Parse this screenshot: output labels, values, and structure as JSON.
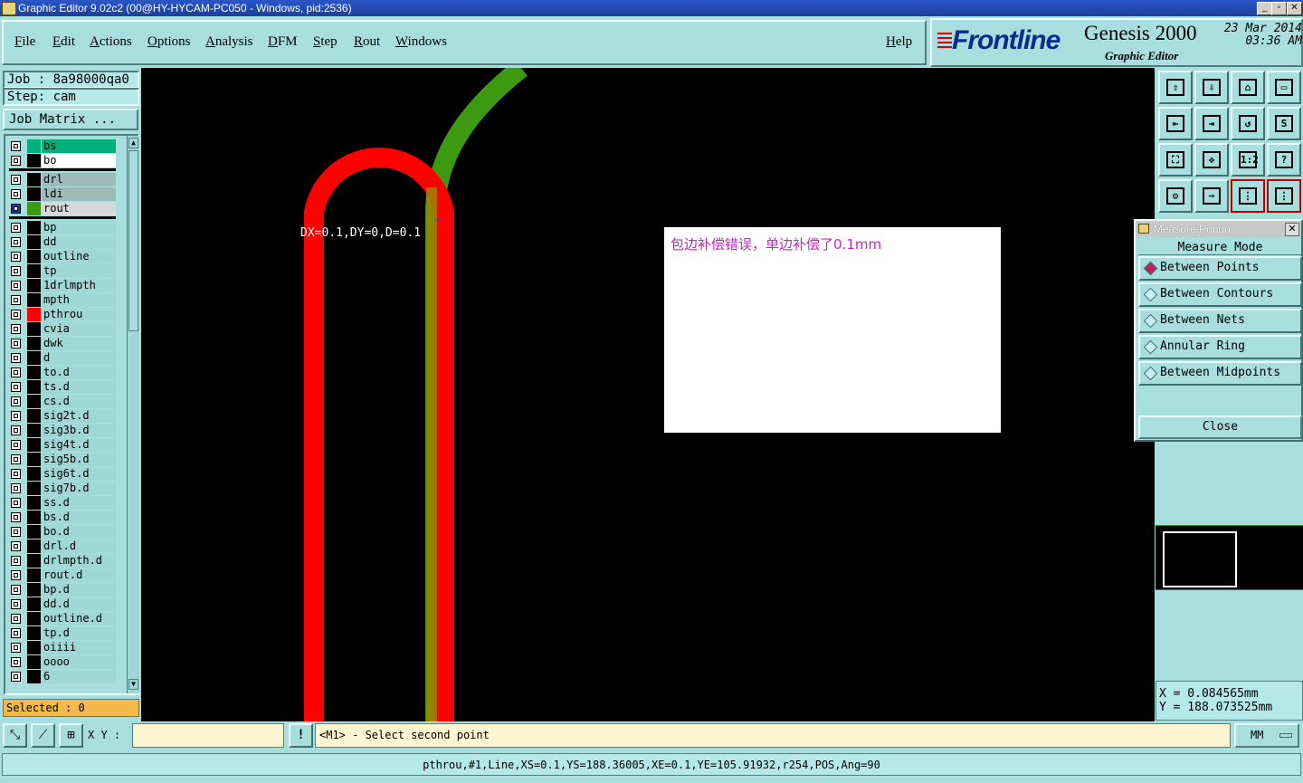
{
  "window": {
    "title": "Graphic Editor 9.02c2 (00@HY-HYCAM-PC050 - Windows, pid:2536)",
    "min": "_",
    "max": "▫",
    "close": "✕"
  },
  "menu": {
    "items": [
      "File",
      "Edit",
      "Actions",
      "Options",
      "Analysis",
      "DFM",
      "Step",
      "Rout",
      "Windows"
    ],
    "help": "Help"
  },
  "brand": {
    "logo": "Frontline",
    "product": "Genesis 2000",
    "subtitle": "Graphic Editor",
    "date": "23 Mar 2014",
    "time": "03:36 AM"
  },
  "job": {
    "job_label": "Job : 8a98000qa0",
    "step_label": "Step: cam",
    "matrix_button": "Job Matrix ..."
  },
  "layers": [
    {
      "name": "bs",
      "color": "#00b07a",
      "highlight": "#00b07a"
    },
    {
      "name": "bo",
      "color": "#000000",
      "highlight": "#ffffff"
    },
    {
      "name": "drl",
      "color": "#000000",
      "highlight": "#9fb8b8"
    },
    {
      "name": "ldi",
      "color": "#000000",
      "highlight": "#9fb8b8"
    },
    {
      "name": "rout",
      "color": "#3a9a10",
      "highlight": "#d8d8d8",
      "active": true
    },
    {
      "name": "bp"
    },
    {
      "name": "dd"
    },
    {
      "name": "outline"
    },
    {
      "name": "tp"
    },
    {
      "name": "1drlmpth"
    },
    {
      "name": "mpth"
    },
    {
      "name": "pthrou",
      "color": "#ff0000",
      "mark": "▪"
    },
    {
      "name": "cvia"
    },
    {
      "name": "dwk"
    },
    {
      "name": "d"
    },
    {
      "name": "to.d",
      "mark": "✎"
    },
    {
      "name": "ts.d"
    },
    {
      "name": "cs.d",
      "mark": "✎"
    },
    {
      "name": "sig2t.d"
    },
    {
      "name": "sig3b.d"
    },
    {
      "name": "sig4t.d"
    },
    {
      "name": "sig5b.d"
    },
    {
      "name": "sig6t.d"
    },
    {
      "name": "sig7b.d"
    },
    {
      "name": "ss.d",
      "mark": "✎"
    },
    {
      "name": "bs.d"
    },
    {
      "name": "bo.d"
    },
    {
      "name": "drl.d"
    },
    {
      "name": "drlmpth.d"
    },
    {
      "name": "rout.d"
    },
    {
      "name": "bp.d"
    },
    {
      "name": "dd.d"
    },
    {
      "name": "outline.d"
    },
    {
      "name": "tp.d"
    },
    {
      "name": "oiiii"
    },
    {
      "name": "oooo"
    },
    {
      "name": "6"
    }
  ],
  "selected": "Selected : 0",
  "canvas": {
    "measure": "DX=0.1,DY=0,D=0.1",
    "note": "包边补偿错误，单边补偿了0.1mm"
  },
  "measure_popup": {
    "title": "Measure Popup",
    "heading": "Measure Mode",
    "options": [
      "Between Points",
      "Between Contours",
      "Between Nets",
      "Annular Ring",
      "Between Midpoints"
    ],
    "selected": "Between Points",
    "close": "Close"
  },
  "tools": [
    "open-icon",
    "save-icon",
    "home-icon",
    "window-icon",
    "prev-icon",
    "next-icon",
    "undo-icon",
    "snap-icon",
    "zoom-fit-icon",
    "pan-icon",
    "scale-icon",
    "help-icon",
    "settings-icon",
    "measure-icon",
    "layers-icon",
    "layers-alt-icon"
  ],
  "coords": {
    "x": "X  = 0.084565mm",
    "y": "Y  = 188.073525mm"
  },
  "bottom": {
    "xy_label": "X Y :",
    "xy_value": "",
    "prompt": "<M1> - Select second point",
    "units": "MM",
    "status": "pthrou,#1,Line,XS=0.1,YS=188.36005,XE=0.1,YE=105.91932,r254,POS,Ang=90"
  }
}
